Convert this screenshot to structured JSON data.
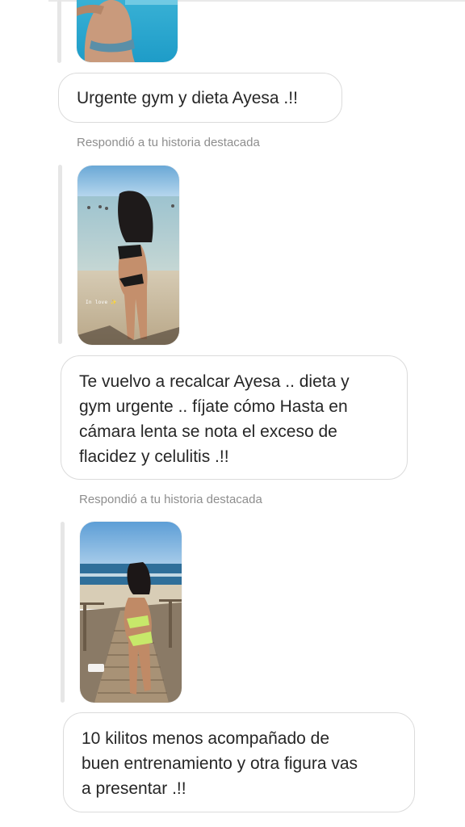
{
  "conversation": {
    "messages": [
      {
        "kind": "story_reply",
        "reply_label": "",
        "thumbnail": "pool-photo-thumbnail",
        "text_lines": [
          "Urgente gym y dieta Ayesa .!!"
        ]
      },
      {
        "kind": "story_reply",
        "reply_label": "Respondió a tu historia destacada",
        "thumbnail": "beach-photo-thumbnail",
        "thumbnail_caption": "In love ✨",
        "text_lines": [
          "Te vuelvo a recalcar Ayesa ..  dieta y",
          "gym urgente ..  fíjate cómo Hasta en",
          "cámara lenta se nota el exceso de",
          "flacidez y celulitis .!!"
        ]
      },
      {
        "kind": "story_reply",
        "reply_label": "Respondió a tu historia destacada",
        "thumbnail": "boardwalk-photo-thumbnail",
        "text_lines": [
          "10 kilitos menos acompañado de",
          "buen entrenamiento y otra figura vas",
          "a presentar .!!"
        ]
      }
    ]
  },
  "colors": {
    "background": "#ffffff",
    "bubble_border": "#dbdbdb",
    "text": "#262626",
    "secondary_text": "#8e8e8e",
    "story_bar": "#e6e6e6"
  }
}
